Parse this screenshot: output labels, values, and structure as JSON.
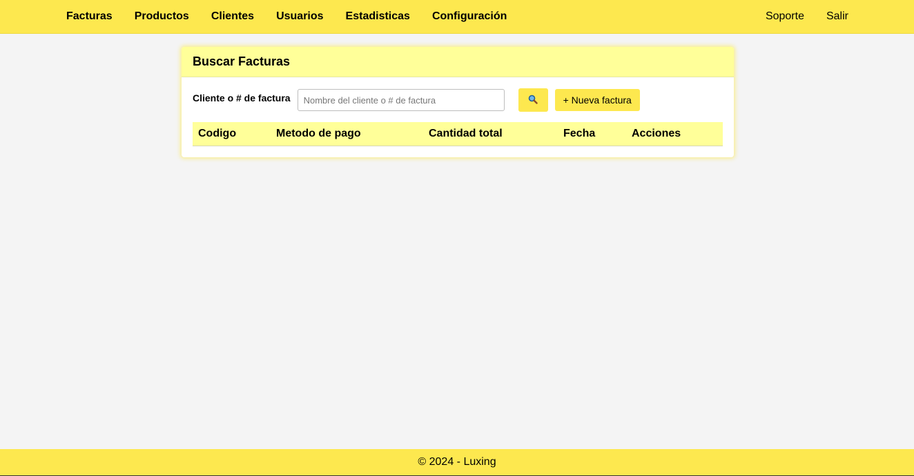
{
  "nav": {
    "left": [
      "Facturas",
      "Productos",
      "Clientes",
      "Usuarios",
      "Estadisticas",
      "Configuración"
    ],
    "right": [
      "Soporte",
      "Salir"
    ]
  },
  "card": {
    "title": "Buscar Facturas",
    "search_label": "Cliente o # de factura",
    "search_placeholder": "Nombre del cliente o # de factura",
    "search_value": "",
    "search_button_icon": "search-icon",
    "new_button_label": "+ Nueva factura"
  },
  "table": {
    "columns": [
      "Codigo",
      "Metodo de pago",
      "Cantidad total",
      "Fecha",
      "Acciones"
    ],
    "rows": []
  },
  "footer": {
    "text": "© 2024 - Luxing"
  },
  "colors": {
    "accent": "#fde84f",
    "header_bg": "#ffff99",
    "page_bg": "#f4f4f4"
  }
}
